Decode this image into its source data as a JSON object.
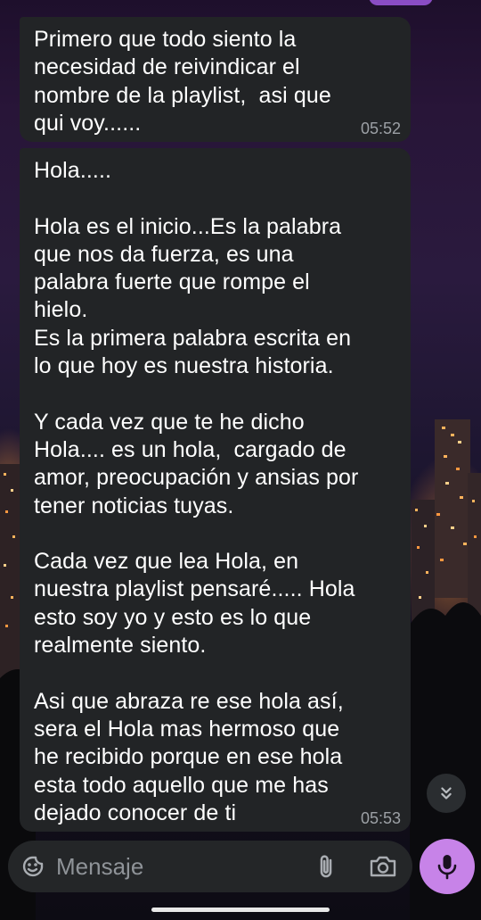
{
  "colors": {
    "bubble": "#222426",
    "accent": "#c783e8",
    "timestamp": "#9ca0a5",
    "input_bar": "#242628"
  },
  "messages": [
    {
      "text": "Primero que todo siento la\nnecesidad de reivindicar el\nnombre de la playlist,  asi que\nqui voy......",
      "time": "05:52"
    },
    {
      "text": "Hola.....\n\nHola es el inicio...Es la palabra\nque nos da fuerza, es una\npalabra fuerte que rompe el\nhielo.\nEs la primera palabra escrita en\nlo que hoy es nuestra historia.\n\nY cada vez que te he dicho\nHola.... es un hola,  cargado de\namor, preocupación y ansias por\ntener noticias tuyas.\n\nCada vez que lea Hola, en\nnuestra playlist pensaré..... Hola\nesto soy yo y esto es lo que\nrealmente siento.\n\nAsi que abraza re ese hola así,\nsera el Hola mas hermoso que\nhe recibido porque en ese hola\nesta todo aquello que me has\ndejado conocer de ti",
      "time": "05:53"
    }
  ],
  "composer": {
    "placeholder": "Mensaje",
    "value": ""
  },
  "icons": {
    "emoji": "sticker-emoji-icon",
    "attach": "paperclip-icon",
    "camera": "camera-icon",
    "mic": "microphone-icon",
    "scroll": "double-chevron-down-icon"
  }
}
